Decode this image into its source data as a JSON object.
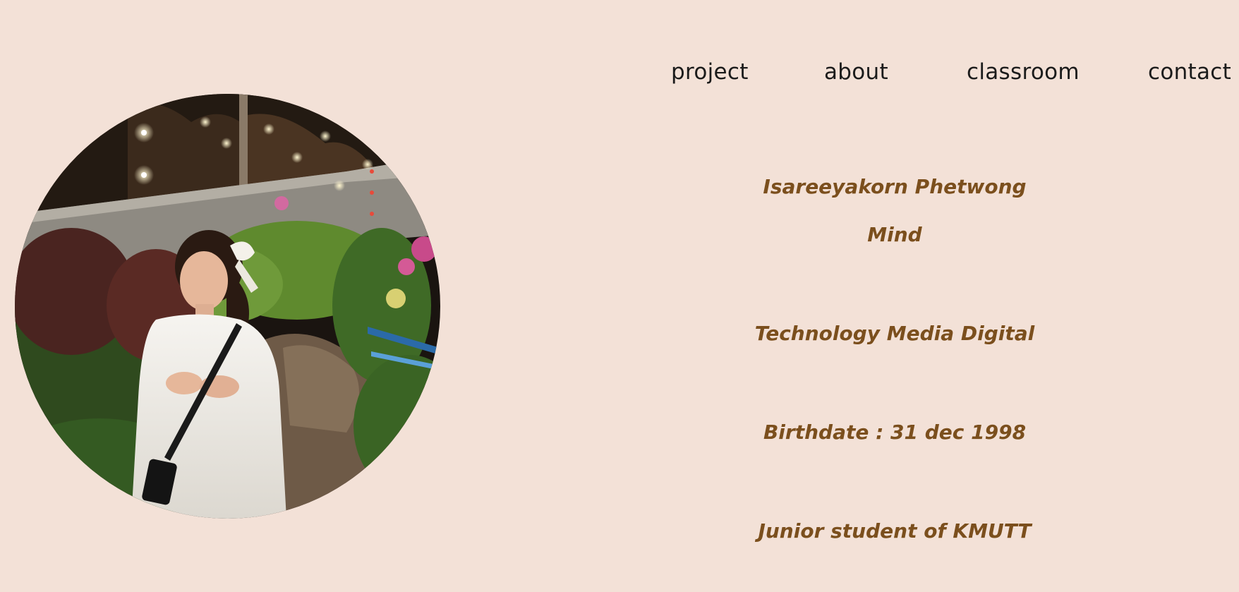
{
  "nav": {
    "items": [
      "project",
      "about",
      "classroom",
      "contact"
    ]
  },
  "profile": {
    "photo_alt": "Portrait photo of a young woman in a white shirt standing in a garden with string lights at night",
    "name": "Isareeyakorn Phetwong",
    "nickname": "Mind",
    "major": "Technology Media Digital",
    "birthdate": "Birthdate : 31 dec 1998",
    "status": "Junior student of KMUTT"
  },
  "colors": {
    "background": "#f3e1d7",
    "nav_text": "#1b1b1b",
    "info_text": "#7b4f1d"
  }
}
